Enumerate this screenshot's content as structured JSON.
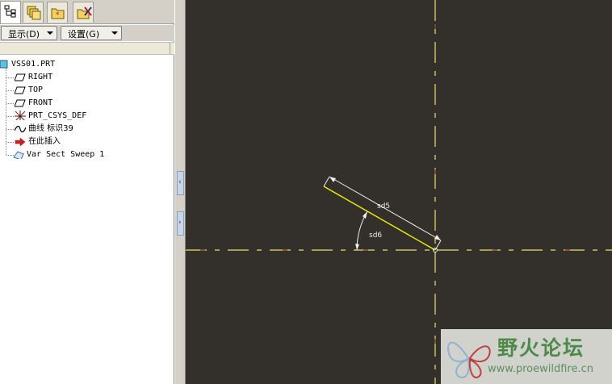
{
  "tabs": [
    {
      "icon": "model-tree-icon",
      "active": true
    },
    {
      "icon": "layers-icon",
      "active": false
    },
    {
      "icon": "folder-browser-icon",
      "active": false
    },
    {
      "icon": "favorites-tools-icon",
      "active": false
    }
  ],
  "toolbar": {
    "show_label": "显示(D)",
    "settings_label": "设置(G)"
  },
  "tree": {
    "root": "VSS01.PRT",
    "items": [
      {
        "label": "RIGHT",
        "icon": "datum-plane-icon"
      },
      {
        "label": "TOP",
        "icon": "datum-plane-icon"
      },
      {
        "label": "FRONT",
        "icon": "datum-plane-icon"
      },
      {
        "label": "PRT_CSYS_DEF",
        "icon": "coordinate-system-icon"
      },
      {
        "label": "曲线 标识39",
        "icon": "curve-icon"
      },
      {
        "label": "在此插入",
        "icon": "insert-here-arrow-icon"
      },
      {
        "label": "Var Sect Sweep 1",
        "icon": "var-sect-sweep-icon"
      }
    ]
  },
  "sketch": {
    "dim_length": "sd5",
    "dim_angle": "sd6",
    "colors": {
      "background": "#33302b",
      "centerline": "#e8e070",
      "centerline_dash_alt": "#a04a30",
      "entity": "#f0f000",
      "dimension": "#f0f0f0"
    }
  },
  "watermark": {
    "title": "野火论坛",
    "url": "www.proewildfire.cn"
  }
}
